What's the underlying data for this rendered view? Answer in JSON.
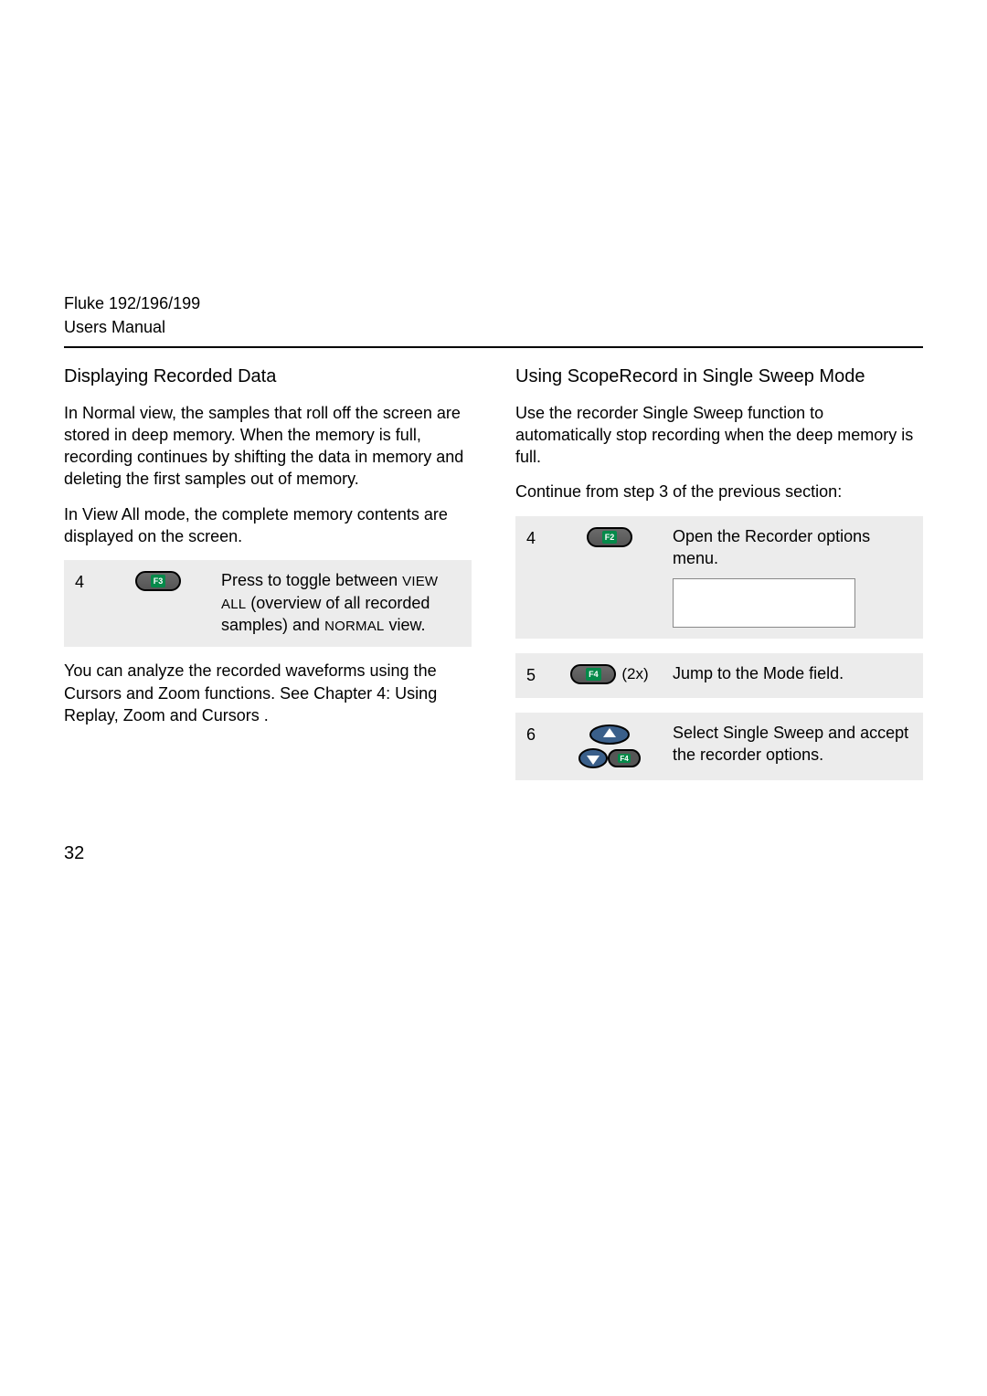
{
  "header": {
    "product": "Fluke 192/196/199",
    "subtitle": "Users Manual"
  },
  "left": {
    "title": "Displaying Recorded Data",
    "p1": "In Normal view, the samples that roll off the screen are stored in deep memory. When the memory is full, recording continues by shifting the data in memory and deleting the first samples out of memory.",
    "p2": "In View All mode, the complete memory contents are displayed on the screen.",
    "step": {
      "num": "4",
      "key": "F3",
      "desc_a": "Press to toggle between ",
      "desc_b": "VIEW ALL",
      "desc_c": " (overview of all recorded samples) and ",
      "desc_d": "NORMAL",
      "desc_e": "  view."
    },
    "p3": "You can analyze the recorded waveforms using the Cursors and Zoom functions. See Chapter 4:  Using Replay, Zoom and Cursors ."
  },
  "right": {
    "title": "Using ScopeRecord in Single Sweep Mode",
    "p1": "Use the recorder Single Sweep  function to automatically stop recording when the deep memory is full.",
    "p2": "Continue from step 3 of the previous section:",
    "steps": [
      {
        "num": "4",
        "key": "F2",
        "note": "",
        "desc": "Open the Recorder options menu."
      },
      {
        "num": "5",
        "key": "F4",
        "note": "(2x)",
        "desc": "Jump to the Mode  field."
      },
      {
        "num": "6",
        "key": "F4",
        "note": "",
        "desc": "Select Single Sweep  and accept the recorder options."
      }
    ]
  },
  "page_number": "32"
}
